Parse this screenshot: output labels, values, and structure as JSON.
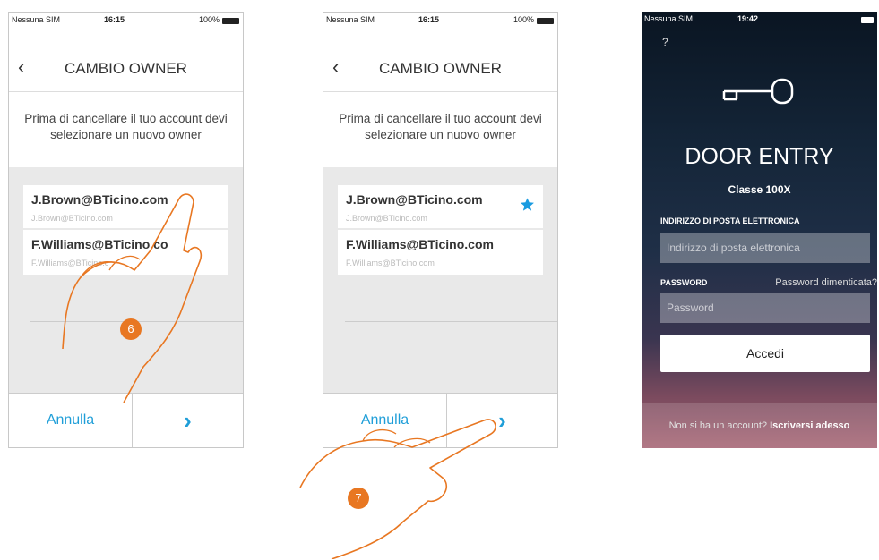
{
  "screen1": {
    "status": {
      "carrier": "Nessuna SIM",
      "time": "16:15",
      "battery": "100%"
    },
    "title": "CAMBIO OWNER",
    "instruction": "Prima di cancellare il tuo account devi selezionare un nuovo owner",
    "accounts": [
      {
        "email": "J.Brown@BTicino.com",
        "sub": "J.Brown@BTicino.com"
      },
      {
        "email": "F.Williams@BTicino.co",
        "sub": "F.Williams@BTicino.c"
      }
    ],
    "cancel_label": "Annulla",
    "next_label": "›",
    "step": "6"
  },
  "screen2": {
    "status": {
      "carrier": "Nessuna SIM",
      "time": "16:15",
      "battery": "100%"
    },
    "title": "CAMBIO OWNER",
    "instruction": "Prima di cancellare il tuo account devi selezionare un nuovo owner",
    "accounts": [
      {
        "email": "J.Brown@BTicino.com",
        "sub": "J.Brown@BTicino.com",
        "selected": true
      },
      {
        "email": "F.Williams@BTicino.com",
        "sub": "F.Williams@BTicino.com"
      }
    ],
    "cancel_label": "Annulla",
    "next_label": "›",
    "step": "7"
  },
  "screen3": {
    "status": {
      "carrier": "Nessuna SIM",
      "time": "19:42"
    },
    "help": "?",
    "app_name": "DOOR ENTRY",
    "app_sub": "Classe 100X",
    "email_label": "INDIRIZZO DI POSTA ELETTRONICA",
    "email_placeholder": "Indirizzo di posta elettronica",
    "password_label": "PASSWORD",
    "forgot_label": "Password dimenticata?",
    "password_placeholder": "Password",
    "login_label": "Accedi",
    "signup_text": "Non si ha un account?",
    "signup_link": "Iscriversi adesso"
  },
  "colors": {
    "accent": "#1f9ed8",
    "badge": "#e87722",
    "star": "#1a9be0"
  }
}
